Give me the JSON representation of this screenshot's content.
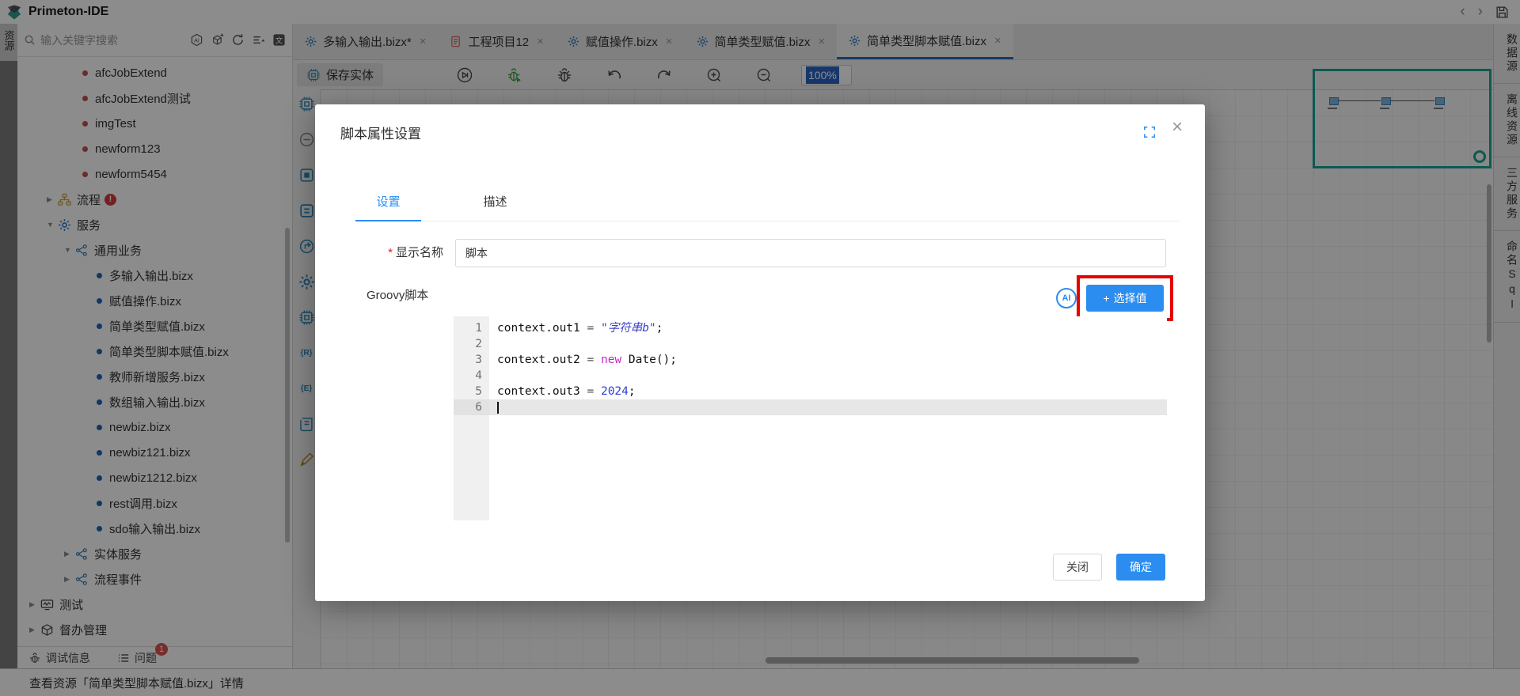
{
  "app": {
    "title": "Primeton-IDE"
  },
  "glyphs": {
    "close": "×",
    "back": "‹",
    "forward": "›",
    "collapsed": "▶",
    "expanded": "▼",
    "plus": "+"
  },
  "left_rail": {
    "active_tab": "资源"
  },
  "sidebar": {
    "search": {
      "placeholder": "输入关键字搜索",
      "action_icons": [
        "ai-search",
        "add-resource",
        "refresh",
        "sort-list",
        "translate"
      ]
    },
    "tree": [
      {
        "indent": "f2",
        "bullet": "red",
        "label": "afcJobExtend"
      },
      {
        "indent": "f2",
        "bullet": "red",
        "label": "afcJobExtend测试"
      },
      {
        "indent": "f2",
        "bullet": "red",
        "label": "imgTest"
      },
      {
        "indent": "f2",
        "bullet": "red",
        "label": "newform123"
      },
      {
        "indent": "f2",
        "bullet": "red",
        "label": "newform5454"
      },
      {
        "indent": "l1",
        "arrow": "collapsed",
        "icon": "flow",
        "label": "流程",
        "badge": "!"
      },
      {
        "indent": "l1",
        "arrow": "expanded",
        "icon": "gear",
        "label": "服务"
      },
      {
        "indent": "l2",
        "arrow": "expanded",
        "icon": "network",
        "label": "通用业务"
      },
      {
        "indent": "f3",
        "bullet": "blue",
        "label": "多输入输出.bizx"
      },
      {
        "indent": "f3",
        "bullet": "blue",
        "label": "赋值操作.bizx"
      },
      {
        "indent": "f3",
        "bullet": "blue",
        "label": "简单类型赋值.bizx"
      },
      {
        "indent": "f3",
        "bullet": "blue",
        "label": "简单类型脚本赋值.bizx"
      },
      {
        "indent": "f3",
        "bullet": "blue",
        "label": "教师新增服务.bizx"
      },
      {
        "indent": "f3",
        "bullet": "blue",
        "label": "数组输入输出.bizx"
      },
      {
        "indent": "f3",
        "bullet": "blue",
        "label": "newbiz.bizx"
      },
      {
        "indent": "f3",
        "bullet": "blue",
        "label": "newbiz121.bizx"
      },
      {
        "indent": "f3",
        "bullet": "blue",
        "label": "newbiz1212.bizx"
      },
      {
        "indent": "f3",
        "bullet": "blue",
        "label": "rest调用.bizx"
      },
      {
        "indent": "f3",
        "bullet": "blue",
        "label": "sdo输入输出.bizx"
      },
      {
        "indent": "l2",
        "arrow": "collapsed",
        "icon": "network",
        "label": "实体服务"
      },
      {
        "indent": "l2",
        "arrow": "collapsed",
        "icon": "network",
        "label": "流程事件"
      },
      {
        "indent": "l0",
        "arrow": "collapsed",
        "icon": "monitor",
        "label": "测试"
      },
      {
        "indent": "l0",
        "arrow": "collapsed",
        "icon": "box",
        "label": "督办管理"
      }
    ],
    "bottom": {
      "debug": "调试信息",
      "problems": "问题",
      "problems_badge": "1"
    }
  },
  "editor": {
    "tabs": [
      {
        "icon": "gear",
        "label": "多输入输出.bizx*",
        "active": false
      },
      {
        "icon": "doc",
        "label": "工程项目12",
        "active": false
      },
      {
        "icon": "gear",
        "label": "赋值操作.bizx",
        "active": false
      },
      {
        "icon": "gear",
        "label": "简单类型赋值.bizx",
        "active": false
      },
      {
        "icon": "gear",
        "label": "简单类型脚本赋值.bizx",
        "active": true
      }
    ],
    "toolbar": {
      "save_entity": "保存实体",
      "icons": [
        "run",
        "debug-run",
        "debug",
        "undo",
        "redo",
        "zoom-in",
        "zoom-out"
      ],
      "zoom_level": "100%"
    },
    "palette_icons": [
      "chip-gear",
      "collapse",
      "stop-node",
      "assign-node",
      "export-node",
      "settings-node",
      "chip-node",
      "rest-node",
      "entity-node",
      "script-node",
      "signature-node"
    ]
  },
  "right_rail": {
    "tabs": [
      "数据源",
      "离线资源",
      "三方服务",
      "命名Sql"
    ]
  },
  "statusbar": {
    "text": "查看资源「简单类型脚本赋值.bizx」详情"
  },
  "modal": {
    "title": "脚本属性设置",
    "tabs": [
      {
        "label": "设置",
        "active": true
      },
      {
        "label": "描述",
        "active": false
      }
    ],
    "display_name": {
      "required": "*",
      "label": "显示名称",
      "value": "脚本"
    },
    "groovy_label": "Groovy脚本",
    "ai_badge": "AI",
    "select_value_button": "选择值",
    "code_lines": [
      {
        "num": "1",
        "tokens": [
          [
            "plain",
            "context.out1"
          ],
          [
            "op",
            " = "
          ],
          [
            "string",
            "\"字符串b\""
          ],
          [
            "plain",
            ";"
          ]
        ]
      },
      {
        "num": "2",
        "tokens": []
      },
      {
        "num": "3",
        "tokens": [
          [
            "plain",
            "context.out2"
          ],
          [
            "op",
            " = "
          ],
          [
            "keyword",
            "new"
          ],
          [
            "plain",
            " Date();"
          ]
        ]
      },
      {
        "num": "4",
        "tokens": []
      },
      {
        "num": "5",
        "tokens": [
          [
            "plain",
            "context.out3"
          ],
          [
            "op",
            " = "
          ],
          [
            "number",
            "2024"
          ],
          [
            "plain",
            ";"
          ]
        ]
      },
      {
        "num": "6",
        "tokens": [],
        "active": true
      }
    ],
    "footer": {
      "close": "关闭",
      "confirm": "确定"
    }
  },
  "colors": {
    "accent": "#2b8df0",
    "tab-underline": "#2a6db5",
    "highlight-red": "#e60000",
    "string": "#3b41c9",
    "keyword": "#c528c5",
    "number": "#2c3ed8",
    "dot-red": "#c0504d",
    "dot-blue": "#2065b5",
    "minimap": "#18a394",
    "badge-red": "#d9534f"
  }
}
